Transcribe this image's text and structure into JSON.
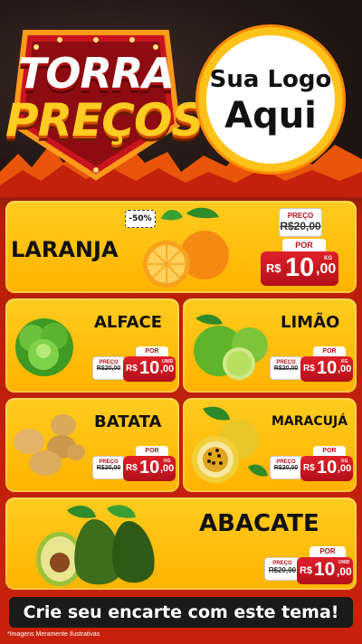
{
  "header": {
    "badge_line1": "TORRA",
    "badge_line2": "PREÇOS",
    "logo_line1": "Sua Logo",
    "logo_line2": "Aqui"
  },
  "products": [
    {
      "name": "LARANJA",
      "discount": "-50%",
      "preco_label": "PREÇO",
      "old_price": "R$20,00",
      "por_label": "POR",
      "currency": "R$",
      "int": "10",
      "dec": ",00",
      "unit": "KG"
    },
    {
      "name": "ALFACE",
      "preco_label": "PREÇO",
      "old_price": "R$20,00",
      "por_label": "POR",
      "currency": "R$",
      "int": "10",
      "dec": ",00",
      "unit": "UNID"
    },
    {
      "name": "LIMÃO",
      "preco_label": "PREÇO",
      "old_price": "R$20,00",
      "por_label": "POR",
      "currency": "R$",
      "int": "10",
      "dec": ",00",
      "unit": "KG"
    },
    {
      "name": "BATATA",
      "preco_label": "PREÇO",
      "old_price": "R$20,00",
      "por_label": "POR",
      "currency": "R$",
      "int": "10",
      "dec": ",00",
      "unit": "KG"
    },
    {
      "name": "MARACUJÁ",
      "preco_label": "PREÇO",
      "old_price": "R$20,00",
      "por_label": "POR",
      "currency": "R$",
      "int": "10",
      "dec": ",00",
      "unit": "KG"
    },
    {
      "name": "ABACATE",
      "preco_label": "PREÇO",
      "old_price": "R$20,00",
      "por_label": "POR",
      "currency": "R$",
      "int": "10",
      "dec": ",00",
      "unit": "UNID"
    }
  ],
  "footer": {
    "cta": "Crie seu encarte com este tema!",
    "disclaimer": "*Imagens Meramente Ilustrativas"
  },
  "colors": {
    "card": "#ffb300",
    "price_red": "#c8141e",
    "background_red": "#c9220c",
    "logo_ring": "#ffc21a"
  }
}
